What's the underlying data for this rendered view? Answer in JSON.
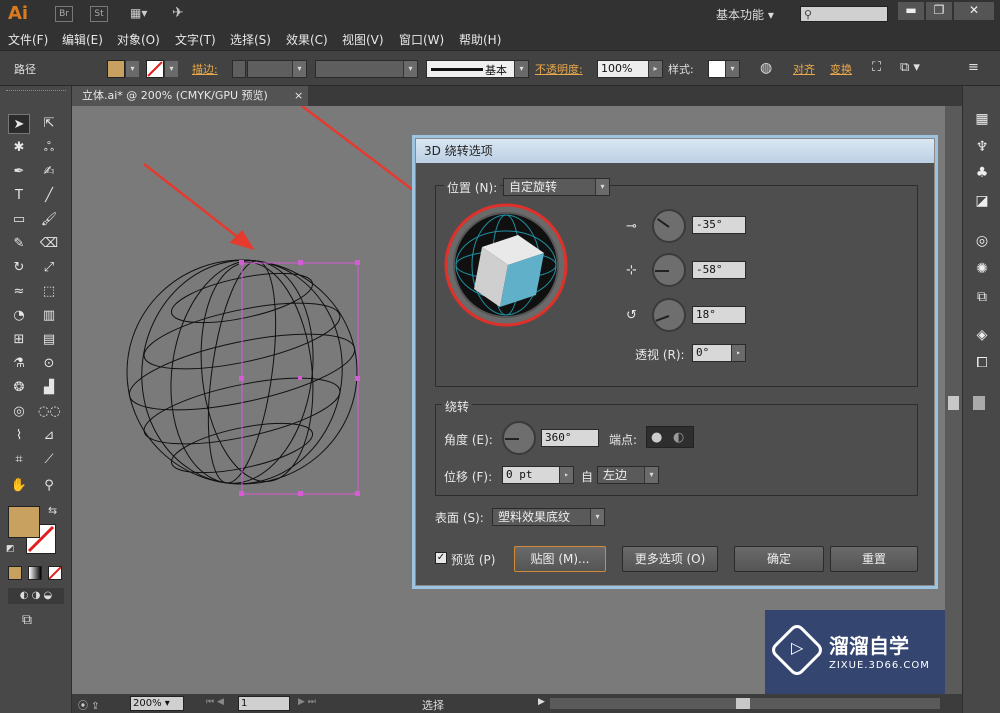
{
  "app": {
    "logo": "Ai",
    "br": "Br",
    "st": "St",
    "workspace": "基本功能",
    "search_placeholder": ""
  },
  "menu": [
    "文件(F)",
    "编辑(E)",
    "对象(O)",
    "文字(T)",
    "选择(S)",
    "效果(C)",
    "视图(V)",
    "窗口(W)",
    "帮助(H)"
  ],
  "control": {
    "object_type": "路径",
    "stroke_label": "描边",
    "stroke_profile": "基本",
    "opacity_label": "不透明度",
    "opacity_value": "100%",
    "style_label": "样式",
    "align_label": "对齐",
    "transform_label": "变换",
    "fill_color": "#c8a060"
  },
  "document_tab": {
    "title": "立体.ai* @ 200% (CMYK/GPU 预览)",
    "close": "×"
  },
  "dialog": {
    "title": "3D 绕转选项",
    "position_label": "位置 (N):",
    "position_value": "自定旋转",
    "x_angle": "-35°",
    "y_angle": "-58°",
    "z_angle": "18°",
    "perspective_label": "透视 (R):",
    "perspective_value": "0°",
    "revolve_group": "绕转",
    "angle_label": "角度 (E):",
    "angle_value": "360°",
    "cap_label": "端点:",
    "offset_label": "位移 (F):",
    "offset_value": "0 pt",
    "from_label": "自",
    "from_value": "左边",
    "surface_label": "表面 (S):",
    "surface_value": "塑料效果底纹",
    "preview_label": "预览 (P)",
    "preview_checked": true,
    "map_button": "贴图 (M)...",
    "more_options_button": "更多选项 (O)",
    "ok_button": "确定",
    "reset_button": "重置"
  },
  "status": {
    "zoom": "200%",
    "page": "1",
    "tool": "选择"
  },
  "watermark": {
    "name": "溜溜自学",
    "url": "ZIXUE.3D66.COM"
  }
}
